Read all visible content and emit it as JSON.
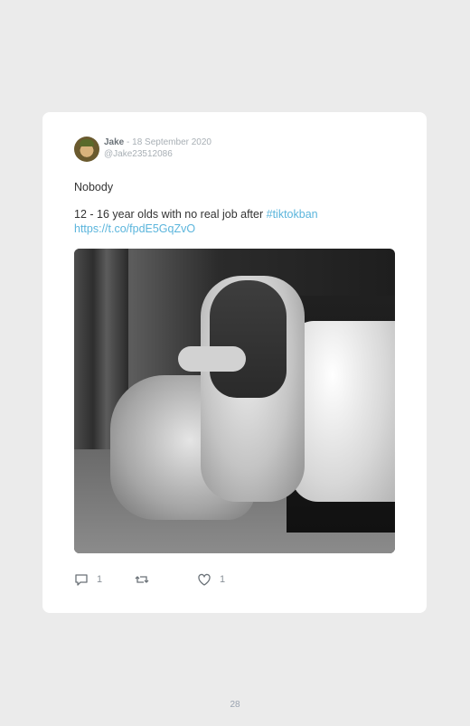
{
  "tweet": {
    "author": {
      "name": "Jake",
      "handle": "@Jake23512086",
      "avatar": "user-avatar"
    },
    "separator": " - ",
    "date": "18 September 2020",
    "lines": {
      "line1": "Nobody",
      "line2": "12 - 16 year olds with no real job after ",
      "hashtag": "#tiktokban",
      "link": "https://t.co/fpdE5GqZvO"
    },
    "image": {
      "description": "black-and-white photo"
    },
    "stats": {
      "replies": "1",
      "retweets": "",
      "likes": "1"
    },
    "icons": {
      "reply": "reply-icon",
      "retweet": "retweet-icon",
      "like": "heart-icon"
    }
  },
  "page": {
    "number": "28"
  },
  "colors": {
    "background": "#ebebeb",
    "card": "#ffffff",
    "link": "#5bb5dc",
    "muted": "#a8afb5"
  }
}
